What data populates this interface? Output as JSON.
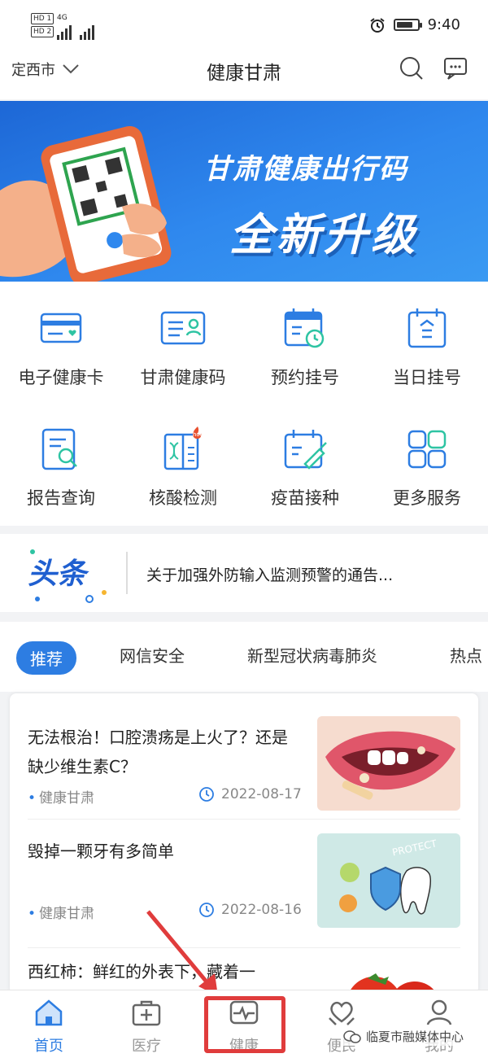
{
  "status_bar": {
    "sim1": "HD 1",
    "sim2": "HD 2",
    "net": "4G",
    "time": "9:40"
  },
  "header": {
    "city": "定西市",
    "title": "健康甘肃",
    "search_icon": "search-icon",
    "message_icon": "message-icon"
  },
  "banner": {
    "line1": "甘肃健康出行码",
    "line2": "全新升级"
  },
  "services": [
    {
      "label": "电子健康卡",
      "icon": "health-card-icon"
    },
    {
      "label": "甘肃健康码",
      "icon": "health-code-icon"
    },
    {
      "label": "预约挂号",
      "icon": "calendar-clock-icon"
    },
    {
      "label": "当日挂号",
      "icon": "calendar-today-icon"
    },
    {
      "label": "报告查询",
      "icon": "report-search-icon"
    },
    {
      "label": "核酸检测",
      "icon": "dna-test-icon",
      "badge": "hot"
    },
    {
      "label": "疫苗接种",
      "icon": "vaccine-icon"
    },
    {
      "label": "更多服务",
      "icon": "grid-icon"
    }
  ],
  "headline": {
    "logo": "头条",
    "text": "关于加强外防输入监测预警的通告..."
  },
  "tabs": [
    "推荐",
    "网信安全",
    "新型冠状病毒肺炎",
    "热点"
  ],
  "feed": [
    {
      "title": "无法根治！口腔溃疡是上火了？还是缺少维生素C？",
      "source": "健康甘肃",
      "date": "2022-08-17"
    },
    {
      "title": "毁掉一颗牙有多简单",
      "source": "健康甘肃",
      "date": "2022-08-16",
      "thumb_text": "PROTECT"
    },
    {
      "title": "西红柿：鲜红的外表下，藏着一",
      "source": "",
      "date": ""
    }
  ],
  "tabbar": [
    {
      "label": "首页",
      "icon": "home-icon",
      "active": true
    },
    {
      "label": "医疗",
      "icon": "medical-kit-icon",
      "active": false
    },
    {
      "label": "健康",
      "icon": "heartbeat-icon",
      "active": false
    },
    {
      "label": "便民",
      "icon": "heart-hands-icon",
      "active": false
    },
    {
      "label": "我的",
      "icon": "user-icon",
      "active": false
    }
  ],
  "watermark": "临夏市融媒体中心",
  "colors": {
    "accent": "#2d7de2",
    "highlight": "#e03c3c"
  }
}
